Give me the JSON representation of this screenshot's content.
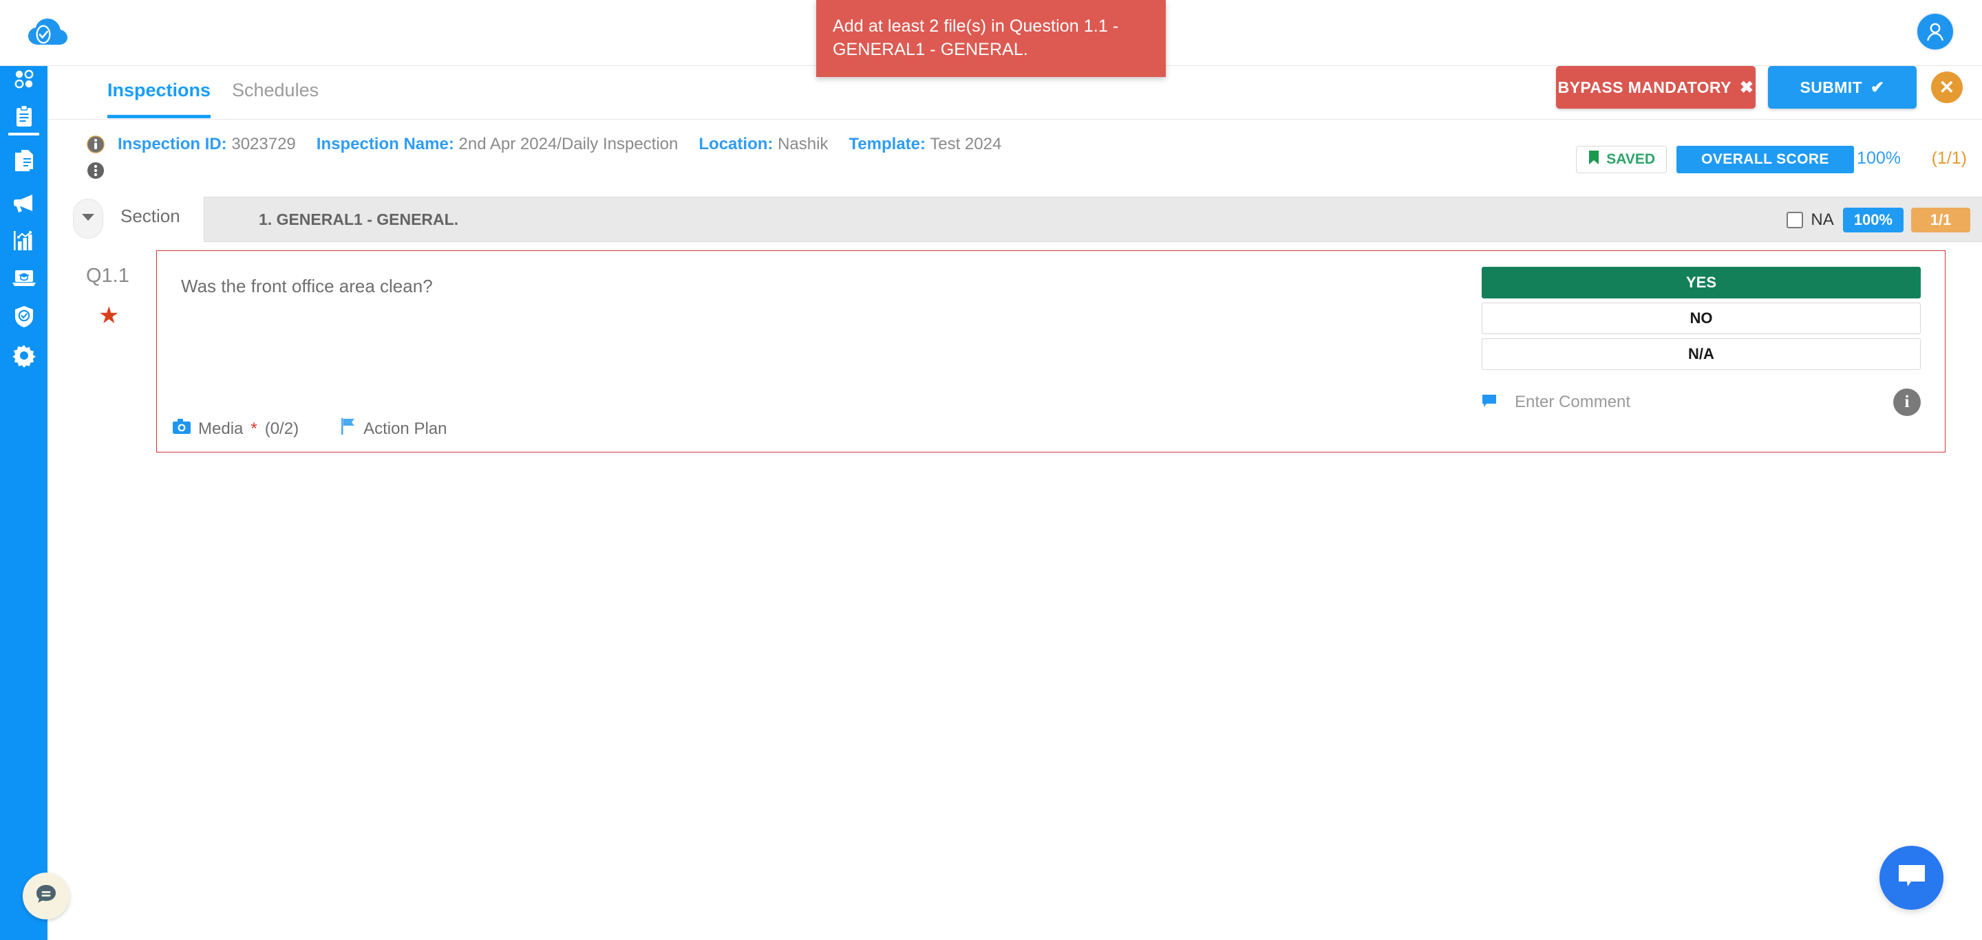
{
  "app": {
    "logo_icon": "cloud-check-logo",
    "avatar_icon": "user-avatar-icon"
  },
  "toast": {
    "message": "Add at least 2 file(s) in Question 1.1 - GENERAL1 - GENERAL.",
    "bg_color": "#dd5a52"
  },
  "sidebar": {
    "bg_color": "#0d93f5",
    "items": [
      {
        "name": "dashboard",
        "icon": "grid-dots-icon",
        "active": false
      },
      {
        "name": "inspections",
        "icon": "clipboard-icon",
        "active": true
      },
      {
        "name": "documents",
        "icon": "documents-icon",
        "active": false
      },
      {
        "name": "announcements",
        "icon": "megaphone-icon",
        "active": false
      },
      {
        "name": "analytics",
        "icon": "bar-chart-icon",
        "active": false
      },
      {
        "name": "training",
        "icon": "graduation-laptop-icon",
        "active": false
      },
      {
        "name": "compliance",
        "icon": "shield-check-icon",
        "active": false
      },
      {
        "name": "settings",
        "icon": "gear-icon",
        "active": false
      }
    ]
  },
  "tabs": [
    {
      "label": "Inspections",
      "active": true
    },
    {
      "label": "Schedules",
      "active": false
    }
  ],
  "toolbar": {
    "bypass_label": "BYPASS MANDATORY",
    "bypass_icon": "cross-icon",
    "submit_label": "SUBMIT",
    "submit_icon": "check-icon",
    "close_icon": "close-x-icon",
    "bypass_color": "#da574f",
    "submit_color": "#1f9bf4",
    "close_color": "#e59a32"
  },
  "meta": {
    "info_icon": "info-circle-icon",
    "more_icon": "info-vertical-icon",
    "fields": [
      {
        "label": "Inspection ID:",
        "value": "3023729"
      },
      {
        "label": "Inspection Name:",
        "value": "2nd Apr 2024/Daily Inspection"
      },
      {
        "label": "Location:",
        "value": "Nashik"
      },
      {
        "label": "Template:",
        "value": "Test 2024"
      }
    ],
    "saved_label": "SAVED",
    "saved_icon": "bookmark-flag-icon",
    "overall_score_label": "OVERALL SCORE",
    "score_percent": "100%",
    "score_fraction": "(1/1)"
  },
  "section": {
    "collapse_icon": "chevron-down-icon",
    "label": "Section",
    "title": "1. GENERAL1 - GENERAL.",
    "na_label": "NA",
    "na_checked": false,
    "percent_pill": "100%",
    "count_pill": "1/1"
  },
  "question": {
    "number": "Q1.1",
    "mandatory_icon": "red-star-icon",
    "text": "Was the front office area clean?",
    "answers": [
      {
        "label": "YES",
        "selected": true
      },
      {
        "label": "NO",
        "selected": false
      },
      {
        "label": "N/A",
        "selected": false
      }
    ],
    "comment_icon": "comment-bubble-icon",
    "comment_placeholder": "Enter Comment",
    "info_icon": "info-circle-icon",
    "info_glyph": "i",
    "media_icon": "camera-icon",
    "media_label": "Media",
    "media_required_mark": "*",
    "media_count": "(0/2)",
    "action_plan_icon": "flag-icon",
    "action_plan_label": "Action Plan",
    "selected_color": "#13805a",
    "border_color": "#cf3232"
  },
  "widgets": {
    "left_chat_icon": "chat-bubble-icon",
    "right_chat_icon": "message-bubble-icon"
  }
}
